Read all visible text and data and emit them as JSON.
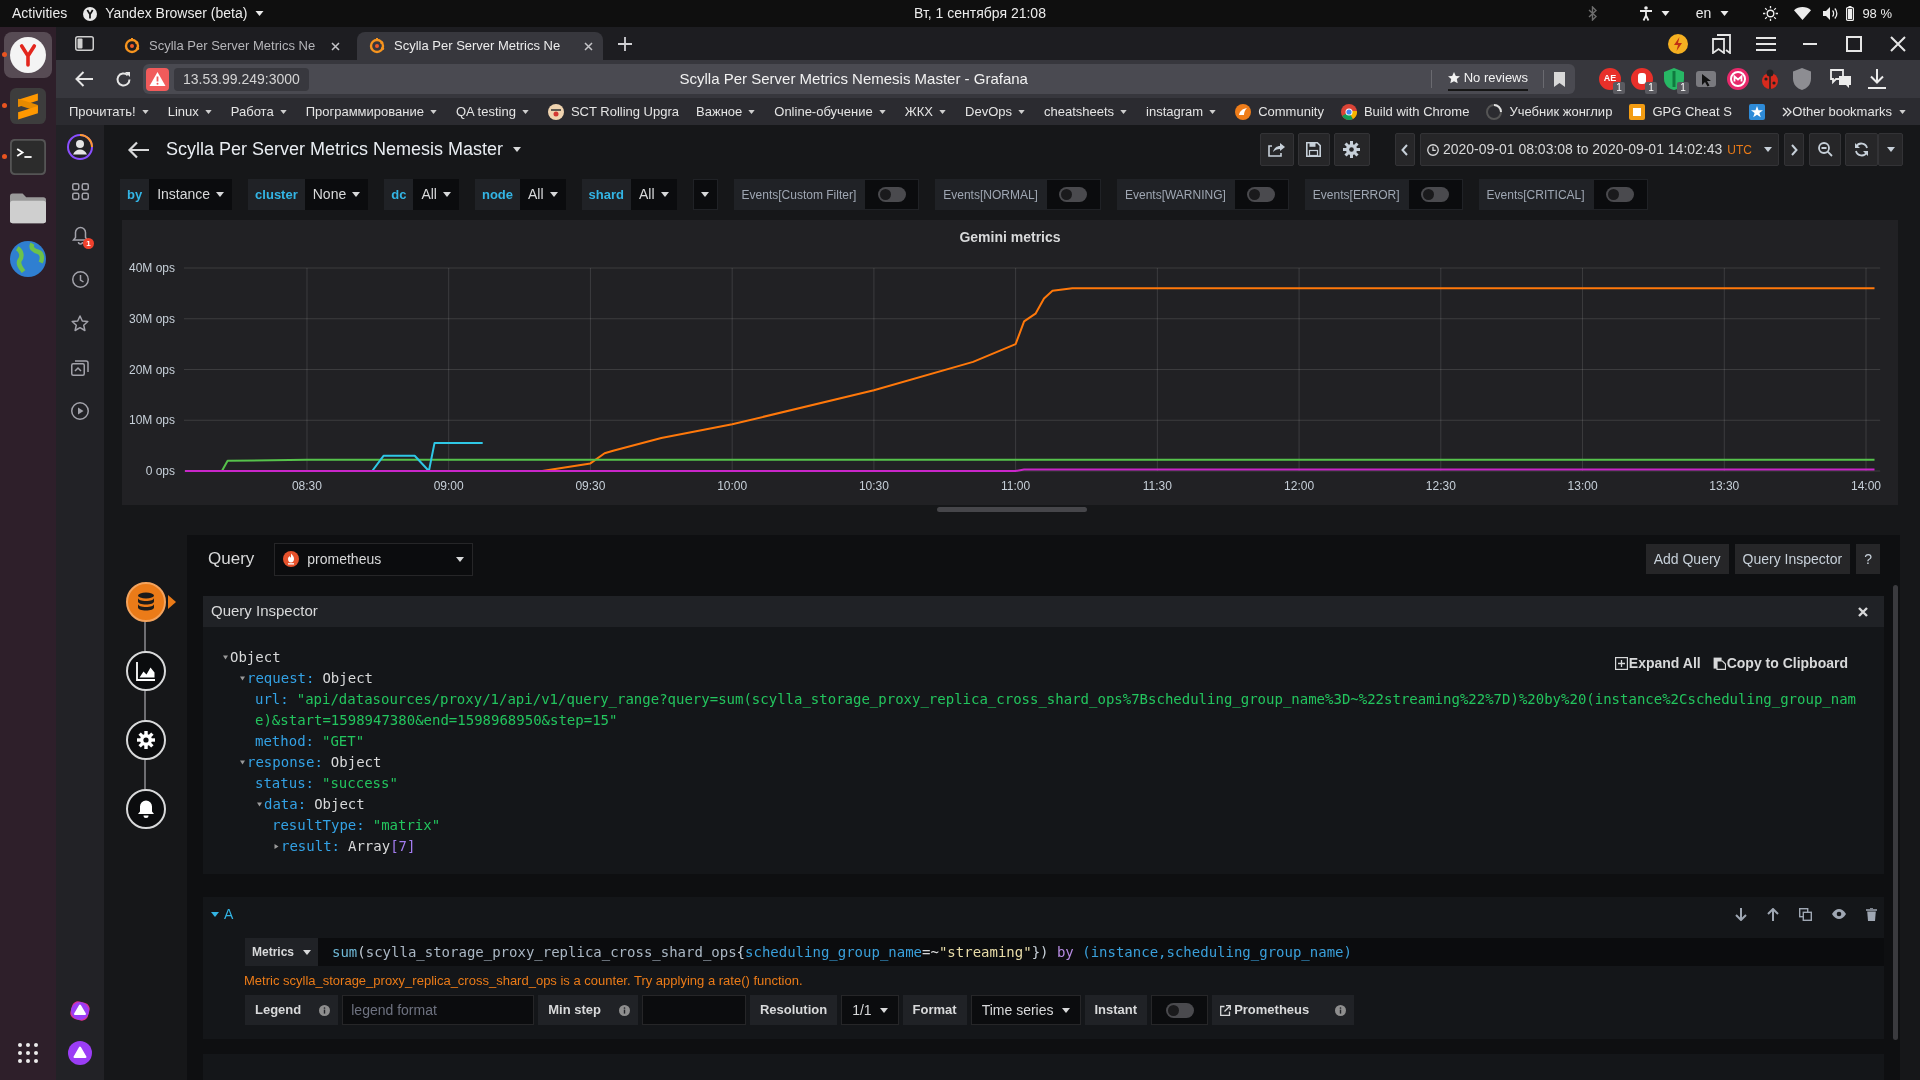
{
  "system_bar": {
    "activities": "Activities",
    "app_menu": "Yandex Browser (beta)",
    "clock": "Вт, 1 сентября 21:08",
    "keyboard_layout": "en",
    "battery": "98 %"
  },
  "dock": [
    {
      "running": true,
      "selected": true
    },
    {
      "running": true,
      "selected": false
    },
    {
      "running": true,
      "selected": false
    },
    {
      "running": false,
      "selected": false
    },
    {
      "running": false,
      "selected": false
    }
  ],
  "browser": {
    "tabs": [
      {
        "title": "Scylla Per Server Metrics Ne",
        "selected": false
      },
      {
        "title": "Scylla Per Server Metrics Ne",
        "selected": true
      }
    ],
    "address": "13.53.99.249:3000",
    "page_title": "Scylla Per Server Metrics Nemesis Master - Grafana",
    "reviews": "No reviews",
    "extensions": [
      {
        "label": "AE",
        "badge": "1"
      },
      {
        "badge": "1"
      },
      {
        "badge": "1"
      }
    ],
    "bookmarks": [
      {
        "label": "Прочитать!",
        "kind": "folder"
      },
      {
        "label": "Linux",
        "kind": "folder"
      },
      {
        "label": "Работа",
        "kind": "folder"
      },
      {
        "label": "Программирование",
        "kind": "folder"
      },
      {
        "label": "QA testing",
        "kind": "folder"
      },
      {
        "label": "SCT Rolling Upgra",
        "kind": "link"
      },
      {
        "label": "Важное",
        "kind": "folder"
      },
      {
        "label": "Online-обучение",
        "kind": "folder"
      },
      {
        "label": "ЖКХ",
        "kind": "folder"
      },
      {
        "label": "DevOps",
        "kind": "folder"
      },
      {
        "label": "cheatsheets",
        "kind": "folder"
      },
      {
        "label": "instagram",
        "kind": "folder"
      },
      {
        "label": "Community",
        "kind": "link"
      },
      {
        "label": "Build with Chrome",
        "kind": "link"
      },
      {
        "label": "Учебник жонглир",
        "kind": "link"
      },
      {
        "label": "GPG Cheat S",
        "kind": "link"
      },
      {
        "kind": "link"
      }
    ],
    "other_bookmarks": "Other bookmarks",
    "notification_badge": "1"
  },
  "dashboard": {
    "title": "Scylla Per Server Metrics Nemesis Master",
    "time_range": "2020-09-01 08:03:08 to 2020-09-01 14:02:43",
    "timezone": "UTC"
  },
  "variables": [
    {
      "label": "by",
      "value": "Instance"
    },
    {
      "label": "cluster",
      "value": "None"
    },
    {
      "label": "dc",
      "value": "All"
    },
    {
      "label": "node",
      "value": "All"
    },
    {
      "label": "shard",
      "value": "All"
    }
  ],
  "event_toggles": [
    {
      "label": "Events[Custom Filter]",
      "on": false
    },
    {
      "label": "Events[NORMAL]",
      "on": false
    },
    {
      "label": "Events[WARNING]",
      "on": false
    },
    {
      "label": "Events[ERROR]",
      "on": false
    },
    {
      "label": "Events[CRITICAL]",
      "on": false
    }
  ],
  "panel": {
    "chart_data": {
      "type": "line",
      "title": "Gemini metrics",
      "grid": true,
      "x": [
        8.07,
        8.2,
        8.22,
        8.5,
        8.73,
        8.77,
        8.88,
        8.93,
        8.95,
        9.0,
        9.12,
        9.33,
        9.5,
        9.55,
        9.58,
        9.75,
        10.0,
        10.5,
        10.85,
        11.0,
        11.03,
        11.07,
        11.1,
        11.13,
        11.2,
        11.5,
        12.0,
        13.0,
        14.03
      ],
      "series": [
        {
          "color": "#ff780a",
          "values": [
            null,
            null,
            null,
            null,
            null,
            null,
            null,
            null,
            null,
            null,
            0,
            0,
            1.5,
            3.5,
            4,
            6.5,
            9.2,
            15.9,
            21.5,
            25,
            29.5,
            31,
            34,
            35.5,
            36,
            36,
            36,
            36,
            36
          ]
        },
        {
          "color": "#56c24b",
          "values": [
            0,
            0,
            2,
            2.2,
            2.2,
            2.2,
            2.2,
            2.2,
            2.2,
            2.2,
            2.2,
            2.2,
            2.2,
            2.2,
            2.2,
            2.2,
            2.2,
            2.2,
            2.2,
            2.2,
            2.2,
            2.2,
            2.2,
            2.2,
            2.2,
            2.2,
            2.2,
            2.2,
            2.2
          ]
        },
        {
          "color": "#2fc8e6",
          "values": [
            null,
            null,
            null,
            null,
            0,
            3,
            3,
            0,
            5.5,
            5.5,
            5.5,
            null,
            null,
            null,
            null,
            null,
            null,
            null,
            null,
            null,
            null,
            null,
            null,
            null,
            null,
            null,
            null,
            null,
            null
          ]
        },
        {
          "color": "#c926c9",
          "values": [
            0,
            0,
            0,
            0,
            0,
            0,
            0,
            0,
            0,
            0,
            0,
            0,
            0,
            0,
            0,
            0,
            0,
            0,
            0,
            0,
            0.3,
            0.3,
            0.3,
            0.3,
            0.3,
            0.3,
            0.3,
            0.3,
            0.3
          ]
        }
      ],
      "xlim": [
        8.05,
        14.05
      ],
      "ylim": [
        0,
        40
      ],
      "xticks": [
        {
          "value": 8.5,
          "label": "08:30"
        },
        {
          "value": 9,
          "label": "09:00"
        },
        {
          "value": 9.5,
          "label": "09:30"
        },
        {
          "value": 10,
          "label": "10:00"
        },
        {
          "value": 10.5,
          "label": "10:30"
        },
        {
          "value": 11,
          "label": "11:00"
        },
        {
          "value": 11.5,
          "label": "11:30"
        },
        {
          "value": 12,
          "label": "12:00"
        },
        {
          "value": 12.5,
          "label": "12:30"
        },
        {
          "value": 13,
          "label": "13:00"
        },
        {
          "value": 13.5,
          "label": "13:30"
        },
        {
          "value": 14,
          "label": "14:00"
        }
      ],
      "yticks": [
        {
          "value": 0,
          "label": "0 ops"
        },
        {
          "value": 10,
          "label": "10M ops"
        },
        {
          "value": 20,
          "label": "20M ops"
        },
        {
          "value": 30,
          "label": "30M ops"
        },
        {
          "value": 40,
          "label": "40M ops"
        }
      ]
    }
  },
  "query_editor": {
    "tabs": [
      {
        "selected": true
      },
      {
        "selected": false
      },
      {
        "selected": false
      },
      {
        "selected": false
      }
    ],
    "heading": "Query",
    "datasource": "prometheus",
    "buttons": [
      "Add Query",
      "Query Inspector",
      "?"
    ],
    "inspector": {
      "title": "Query Inspector",
      "actions": [
        "Expand All",
        "Copy to Clipboard"
      ],
      "tree": {
        "value": "Object",
        "kind": "object",
        "expanded": true,
        "children": [
          {
            "key": "request:",
            "value": "Object",
            "kind": "object",
            "expanded": true,
            "children": [
              {
                "key": "url:",
                "value": "\"api/datasources/proxy/1/api/v1/query_range?query=sum(scylla_storage_proxy_replica_cross_shard_ops%7Bscheduling_group_name%3D~%22streaming%22%7D)%20by%20(instance%2Cscheduling_group_name)&start=1598947380&end=1598968950&step=15\"",
                "kind": "string"
              },
              {
                "key": "method:",
                "value": "\"GET\"",
                "kind": "string"
              }
            ]
          },
          {
            "key": "response:",
            "value": "Object",
            "kind": "object",
            "expanded": true,
            "children": [
              {
                "key": "status:",
                "value": "\"success\"",
                "kind": "string"
              },
              {
                "key": "data:",
                "value": "Object",
                "kind": "object",
                "expanded": true,
                "children": [
                  {
                    "key": "resultType:",
                    "value": "\"matrix\"",
                    "kind": "string"
                  },
                  {
                    "key": "result:",
                    "value": "Array",
                    "count": "[7]",
                    "kind": "array",
                    "expanded": false
                  }
                ]
              }
            ]
          }
        ]
      }
    },
    "queries": [
      {
        "ref": "A",
        "expanded": true,
        "editor": "Metrics",
        "expression": [
          {
            "text": "sum",
            "kind": "function"
          },
          {
            "text": "(",
            "kind": "paren"
          },
          {
            "text": "scylla_storage_proxy_replica_cross_shard_ops",
            "kind": "metric"
          },
          {
            "text": "{",
            "kind": "paren"
          },
          {
            "text": "scheduling_group_name",
            "kind": "label"
          },
          {
            "text": "=~",
            "kind": "operator"
          },
          {
            "text": "\"streaming\"",
            "kind": "string"
          },
          {
            "text": "})",
            "kind": "paren"
          },
          {
            "text": " by ",
            "kind": "keyword"
          },
          {
            "text": "(instance,scheduling_group_name)",
            "kind": "label"
          }
        ],
        "warning": "Metric scylla_storage_proxy_replica_cross_shard_ops is a counter. Try applying a rate() function.",
        "options": [
          {
            "kind": "label",
            "text": "Legend",
            "info": true
          },
          {
            "kind": "input",
            "placeholder": "legend format"
          },
          {
            "kind": "label",
            "text": "Min step",
            "info": true
          },
          {
            "kind": "input"
          },
          {
            "kind": "label",
            "text": "Resolution"
          },
          {
            "kind": "select",
            "value": "1/1"
          },
          {
            "kind": "label",
            "text": "Format"
          },
          {
            "kind": "select",
            "value": "Time series"
          },
          {
            "kind": "label",
            "text": "Instant"
          },
          {
            "kind": "switch",
            "on": false
          },
          {
            "kind": "link",
            "text": "Prometheus",
            "info": true
          }
        ]
      }
    ]
  }
}
